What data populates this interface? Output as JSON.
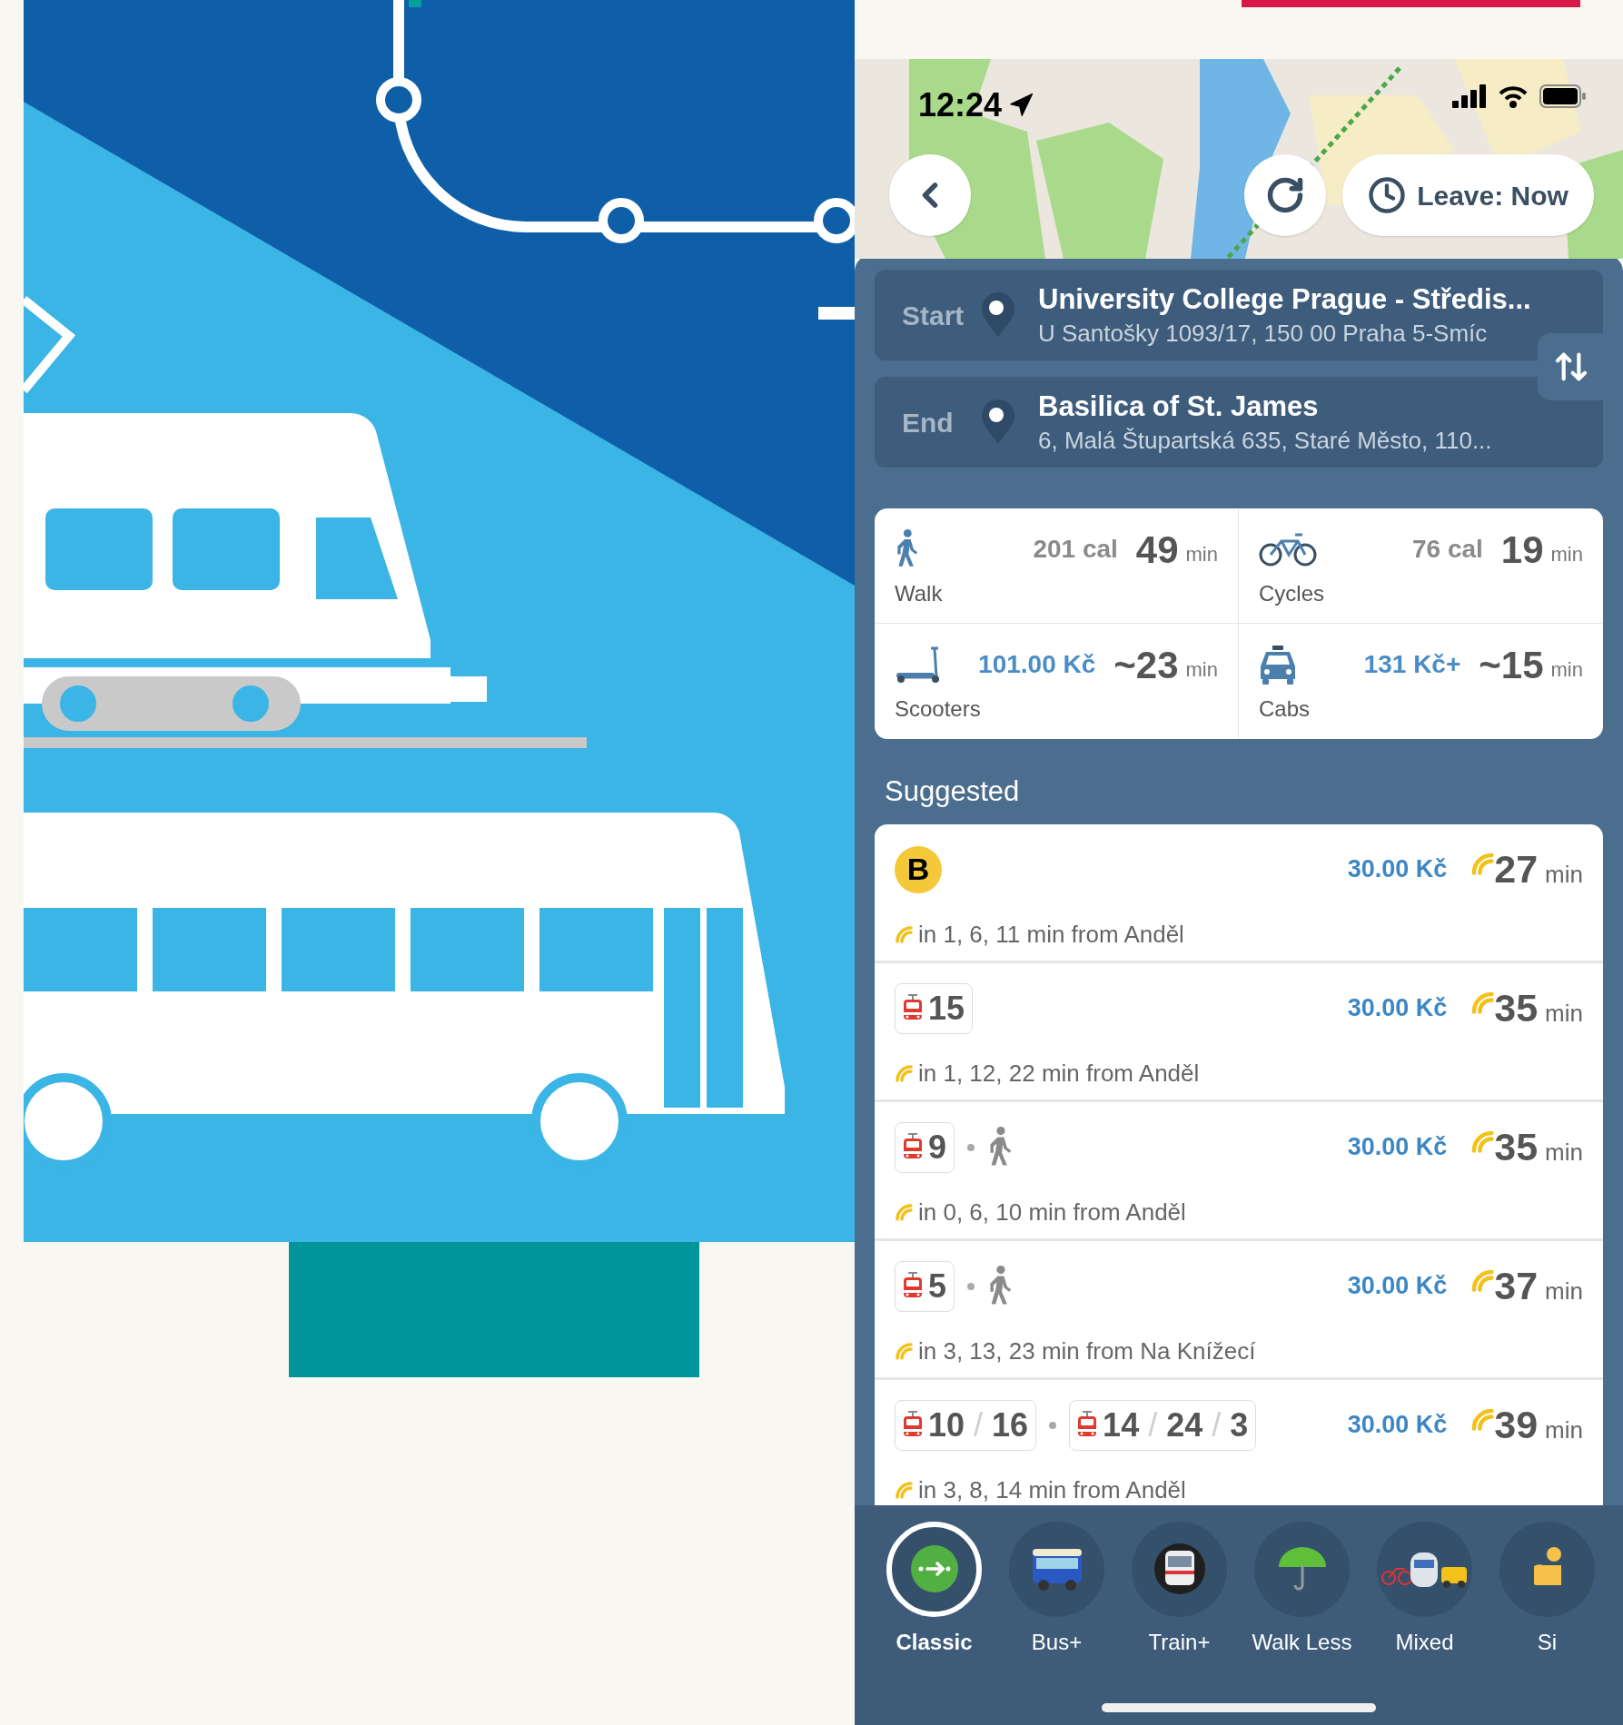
{
  "status_bar": {
    "time": "12:24"
  },
  "map": {
    "leave_button": "Leave: Now"
  },
  "trip": [
    {
      "label": "Start",
      "name": "University College Prague - Středis...",
      "address": "U Santošky 1093/17, 150 00 Praha 5-Smíc"
    },
    {
      "label": "End",
      "name": "Basilica of St. James",
      "address": "6, Malá Štupartská 635, Staré Město, 110..."
    }
  ],
  "modes": [
    {
      "kind": "walk",
      "label": "Walk",
      "detail": "201 cal",
      "detail_is_price": false,
      "time": "49",
      "unit": "min"
    },
    {
      "kind": "bicycle",
      "label": "Cycles",
      "detail": "76 cal",
      "detail_is_price": false,
      "time": "19",
      "unit": "min"
    },
    {
      "kind": "scooter",
      "label": "Scooters",
      "detail": "101.00 Kč",
      "detail_is_price": true,
      "time": "~23",
      "unit": "min"
    },
    {
      "kind": "taxi",
      "label": "Cabs",
      "detail": "131 Kč+",
      "detail_is_price": true,
      "time": "~15",
      "unit": "min"
    }
  ],
  "suggested_title": "Suggested",
  "routes": [
    {
      "legs": [
        {
          "kind": "metro",
          "lines": [
            "B"
          ]
        }
      ],
      "price": "30.00 Kč",
      "time": "27",
      "unit": "min",
      "departures": "in 1, 6, 11 min from Anděl"
    },
    {
      "legs": [
        {
          "kind": "tram",
          "lines": [
            "15"
          ]
        }
      ],
      "price": "30.00 Kč",
      "time": "35",
      "unit": "min",
      "departures": "in 1, 12, 22 min from Anděl"
    },
    {
      "legs": [
        {
          "kind": "tram",
          "lines": [
            "9"
          ]
        },
        {
          "kind": "walk"
        }
      ],
      "price": "30.00 Kč",
      "time": "35",
      "unit": "min",
      "departures": "in 0, 6, 10 min from Anděl"
    },
    {
      "legs": [
        {
          "kind": "tram",
          "lines": [
            "5"
          ]
        },
        {
          "kind": "walk"
        }
      ],
      "price": "30.00 Kč",
      "time": "37",
      "unit": "min",
      "departures": "in 3, 13, 23 min from Na Knížecí"
    },
    {
      "legs": [
        {
          "kind": "tram",
          "lines": [
            "10",
            "16"
          ]
        },
        {
          "kind": "tram",
          "lines": [
            "14",
            "24",
            "3"
          ]
        }
      ],
      "price": "30.00 Kč",
      "time": "39",
      "unit": "min",
      "departures": "in 3, 8, 14 min from Anděl"
    }
  ],
  "line_separator": "/",
  "profiles": [
    {
      "kind": "classic",
      "label": "Classic",
      "selected": true
    },
    {
      "kind": "bus",
      "label": "Bus+",
      "selected": false
    },
    {
      "kind": "train",
      "label": "Train+",
      "selected": false
    },
    {
      "kind": "umbrella",
      "label": "Walk Less",
      "selected": false
    },
    {
      "kind": "mixed",
      "label": "Mixed",
      "selected": false
    },
    {
      "kind": "person",
      "label": "Si",
      "selected": false
    }
  ]
}
